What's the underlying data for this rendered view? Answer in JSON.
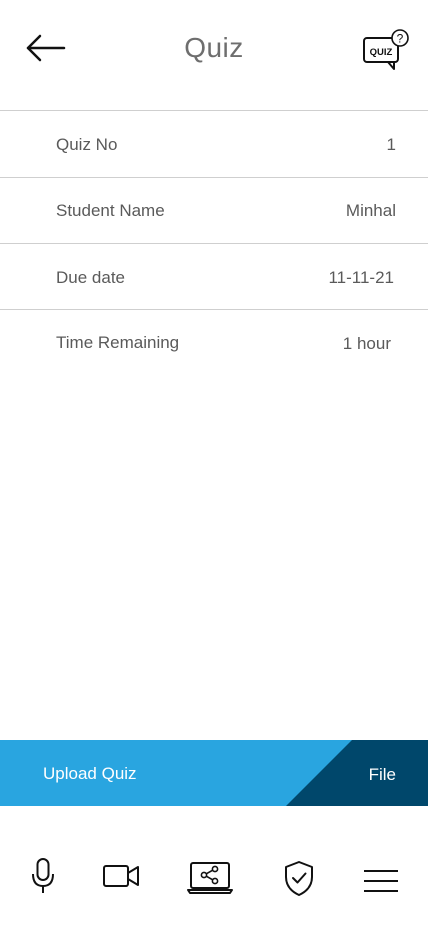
{
  "header": {
    "title": "Quiz",
    "back_icon": "arrow-left-icon",
    "quiz_icon": "quiz-speech-bubble-icon",
    "quiz_icon_text": "QUIZ"
  },
  "details": [
    {
      "label": "Quiz No",
      "value": "1"
    },
    {
      "label": "Student Name",
      "value": "Minhal"
    },
    {
      "label": "Due date",
      "value": "11-11-21"
    },
    {
      "label": "Time Remaining",
      "value": "1 hour"
    }
  ],
  "upload": {
    "label": "Upload Quiz",
    "file_label": "File",
    "color": "#29a5e0",
    "dark_color": "#00476b"
  },
  "toolbar": {
    "items": [
      "microphone-icon",
      "video-camera-icon",
      "screen-share-icon",
      "shield-check-icon",
      "menu-icon"
    ]
  }
}
